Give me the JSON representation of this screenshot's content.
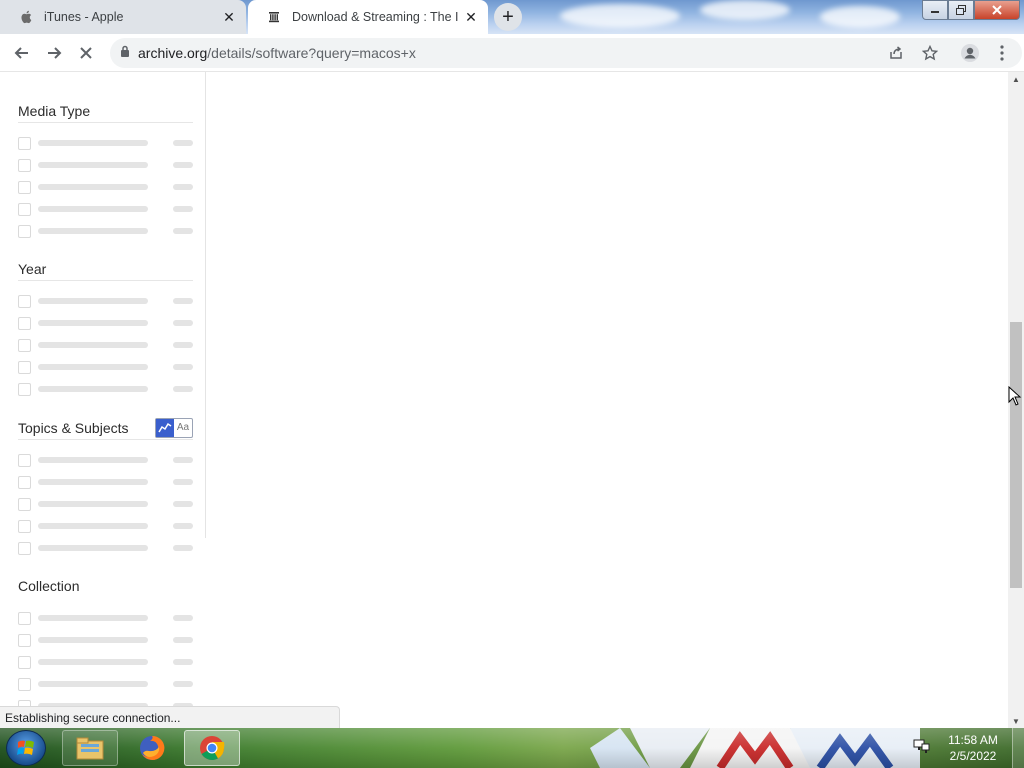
{
  "browser": {
    "tabs": [
      {
        "title": "iTunes - Apple",
        "favicon": "apple-icon",
        "active": false
      },
      {
        "title": "Download & Streaming : The Inte",
        "favicon": "archive-icon",
        "active": true
      }
    ],
    "new_tab_label": "+",
    "close_glyph": "✕",
    "url": {
      "domain": "archive.org",
      "path": "/details/software?query=macos+x"
    },
    "toolbar_icons": [
      "back-arrow-icon",
      "forward-arrow-icon",
      "stop-loading-icon",
      "lock-icon",
      "share-icon",
      "star-icon",
      "profile-icon",
      "menu-icon"
    ]
  },
  "sidebar": {
    "groups": [
      {
        "title": "Media Type",
        "rows": 5
      },
      {
        "title": "Year",
        "rows": 5
      },
      {
        "title": "Topics & Subjects",
        "rows": 5,
        "toggle_text_label": "Aa"
      },
      {
        "title": "Collection",
        "rows": 5
      }
    ]
  },
  "status_bar": {
    "text": "Establishing secure connection..."
  },
  "taskbar": {
    "apps": [
      "start-orb-icon",
      "file-explorer-icon",
      "firefox-icon",
      "chrome-icon"
    ],
    "clock": {
      "time": "11:58 AM",
      "date": "2/5/2022"
    }
  },
  "colors": {
    "accent": "#3a5fcd",
    "placeholder": "#e4e4e4",
    "tab_inactive": "#dfe3e8",
    "omnibox": "#f1f3f4"
  }
}
